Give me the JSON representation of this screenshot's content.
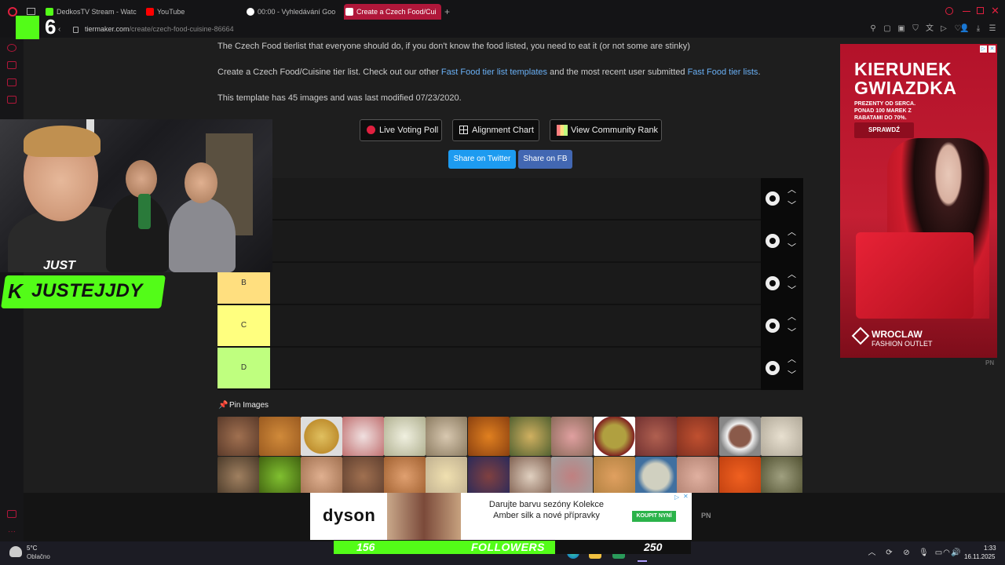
{
  "browser": {
    "tabs": [
      {
        "label": "DedkosTV Stream - Watc",
        "favicon_color": "#53fc18"
      },
      {
        "label": "YouTube",
        "favicon_color": "#ff0000"
      },
      {
        "label": "00:00 - Vyhledávání Goo",
        "favicon_color": "#ffffff"
      },
      {
        "label": "Create a Czech Food/Cui",
        "favicon_color": "#ffffff",
        "active": true
      }
    ],
    "new_tab": "+",
    "url_host": "tiermaker.com",
    "url_path": "/create/czech-food-cuisine-86664"
  },
  "page": {
    "intro": "The Czech Food tierlist that everyone should do, if you don't know the food listed, you need to eat it (or not some are stinky)",
    "create_pre": "Create a Czech Food/Cuisine tier list. Check out our other ",
    "create_link1": "Fast Food tier list templates",
    "create_mid": " and the most recent user submitted ",
    "create_link2": "Fast Food tier lists",
    "create_post": ".",
    "template_info": "This template has 45 images and was last modified 07/23/2020.",
    "buttons": {
      "live_voting": "Live Voting Poll",
      "alignment": "Alignment Chart",
      "community": "View Community Rank"
    },
    "share": {
      "twitter": "Share on Twitter",
      "fb": "Share on FB"
    },
    "tiers": [
      {
        "label": "",
        "color": "#ff7f7f"
      },
      {
        "label": "",
        "color": "#ffbf7f"
      },
      {
        "label": "B",
        "color": "#ffdf7f"
      },
      {
        "label": "C",
        "color": "#ffff7f"
      },
      {
        "label": "D",
        "color": "#bfff7f"
      }
    ],
    "pin_images": "Pin Images"
  },
  "ads": {
    "right": {
      "title": "KIERUNEK GWIAZDKA",
      "subtitle": "PREZENTY OD SERCA. PONAD 100 MAREK Z RABATAMI DO 70%.",
      "cta": "SPRAWDŹ",
      "logo_line1": "WROCLAW",
      "logo_line2": "FASHION OUTLET"
    },
    "pn": "PN",
    "bottom": {
      "brand": "dyson",
      "message": "Darujte barvu sezóny Kolekce Amber silk a nové přípravky",
      "cta": "KOUPIT NYNÍ"
    }
  },
  "stream": {
    "channel_number": "6",
    "streamer_name": "JUSTEJJDY",
    "followers_current": "156",
    "followers_label": "FOLLOWERS",
    "followers_goal": "250",
    "followers_progress": 0.62
  },
  "taskbar": {
    "weather_temp": "5°C",
    "weather_desc": "Oblačno",
    "time": "1:33",
    "date": "16.11.2025"
  },
  "colors": {
    "accent": "#b0173a",
    "kick_green": "#53fc18",
    "link": "#6ab0f5",
    "twitter": "#1d9bf0",
    "facebook": "#4267b2"
  }
}
